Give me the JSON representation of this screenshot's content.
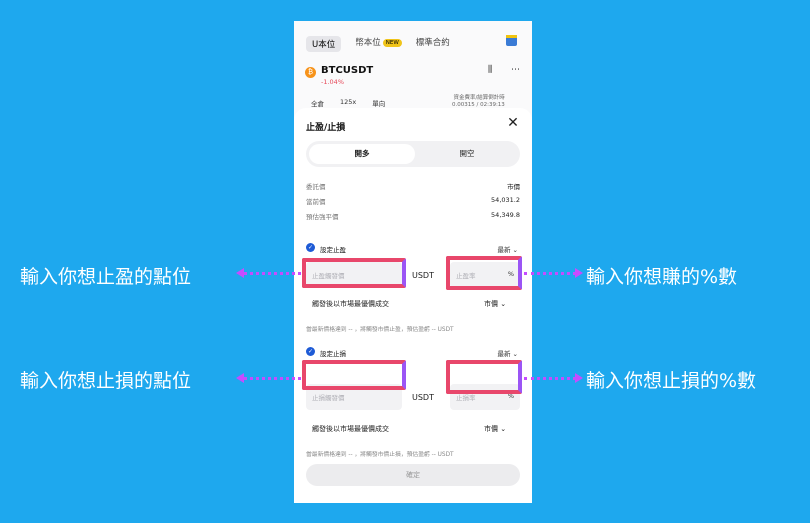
{
  "background": {
    "tabs": [
      "U本位",
      "幣本位",
      "標準合約"
    ],
    "new_badge": "NEW",
    "pair": "BTCUSDT",
    "change": "-1.04%",
    "coin_icon": "₿",
    "icons": "⫼ ⋯",
    "row": [
      "全倉",
      "125x",
      "單向"
    ],
    "right_info": "資金費率/結算倒計時\n0.00315 / 02:39:13"
  },
  "modal": {
    "title": "止盈/止損",
    "close_icon": "✕",
    "tabs": {
      "long": "開多",
      "short": "開空"
    },
    "info": [
      {
        "k": "委託價",
        "v": "市價"
      },
      {
        "k": "當前價",
        "v": "54,031.2"
      },
      {
        "k": "預估強平價",
        "v": "54,349.8"
      }
    ],
    "tp": {
      "label": "設定止盈",
      "price_mode": "最新 ⌄",
      "price_placeholder": "止盈觸發價",
      "unit": "USDT",
      "pct_placeholder": "止盈率",
      "pct_unit": "%",
      "trigger_label": "觸發後以市場最優價成交",
      "trigger_select": "市價 ⌄",
      "note": "當最新價格達到 -- ，將觸發市價止盈，預估盈虧 -- USDT"
    },
    "sl": {
      "label": "設定止損",
      "price_mode": "最新 ⌄",
      "price_placeholder": "止損觸發價",
      "unit": "USDT",
      "pct_placeholder": "止損率",
      "pct_unit": "%",
      "trigger_label": "觸發後以市場最優價成交",
      "trigger_select": "市價 ⌄",
      "note": "當最新價格達到 -- ，將觸發市價止損，預估盈虧 -- USDT"
    },
    "confirm": "確定"
  },
  "annotations": {
    "tp_price": "輸入你想止盈的點位",
    "tp_pct": "輸入你想賺的%數",
    "sl_price": "輸入你想止損的點位",
    "sl_pct": "輸入你想止損的%數"
  },
  "colors": {
    "background": "#1ea8ee",
    "highlight_red": "#e8476b",
    "highlight_purple": "#9b55f5",
    "arrow": "#c64cff",
    "accent": "#1e5bd6"
  }
}
